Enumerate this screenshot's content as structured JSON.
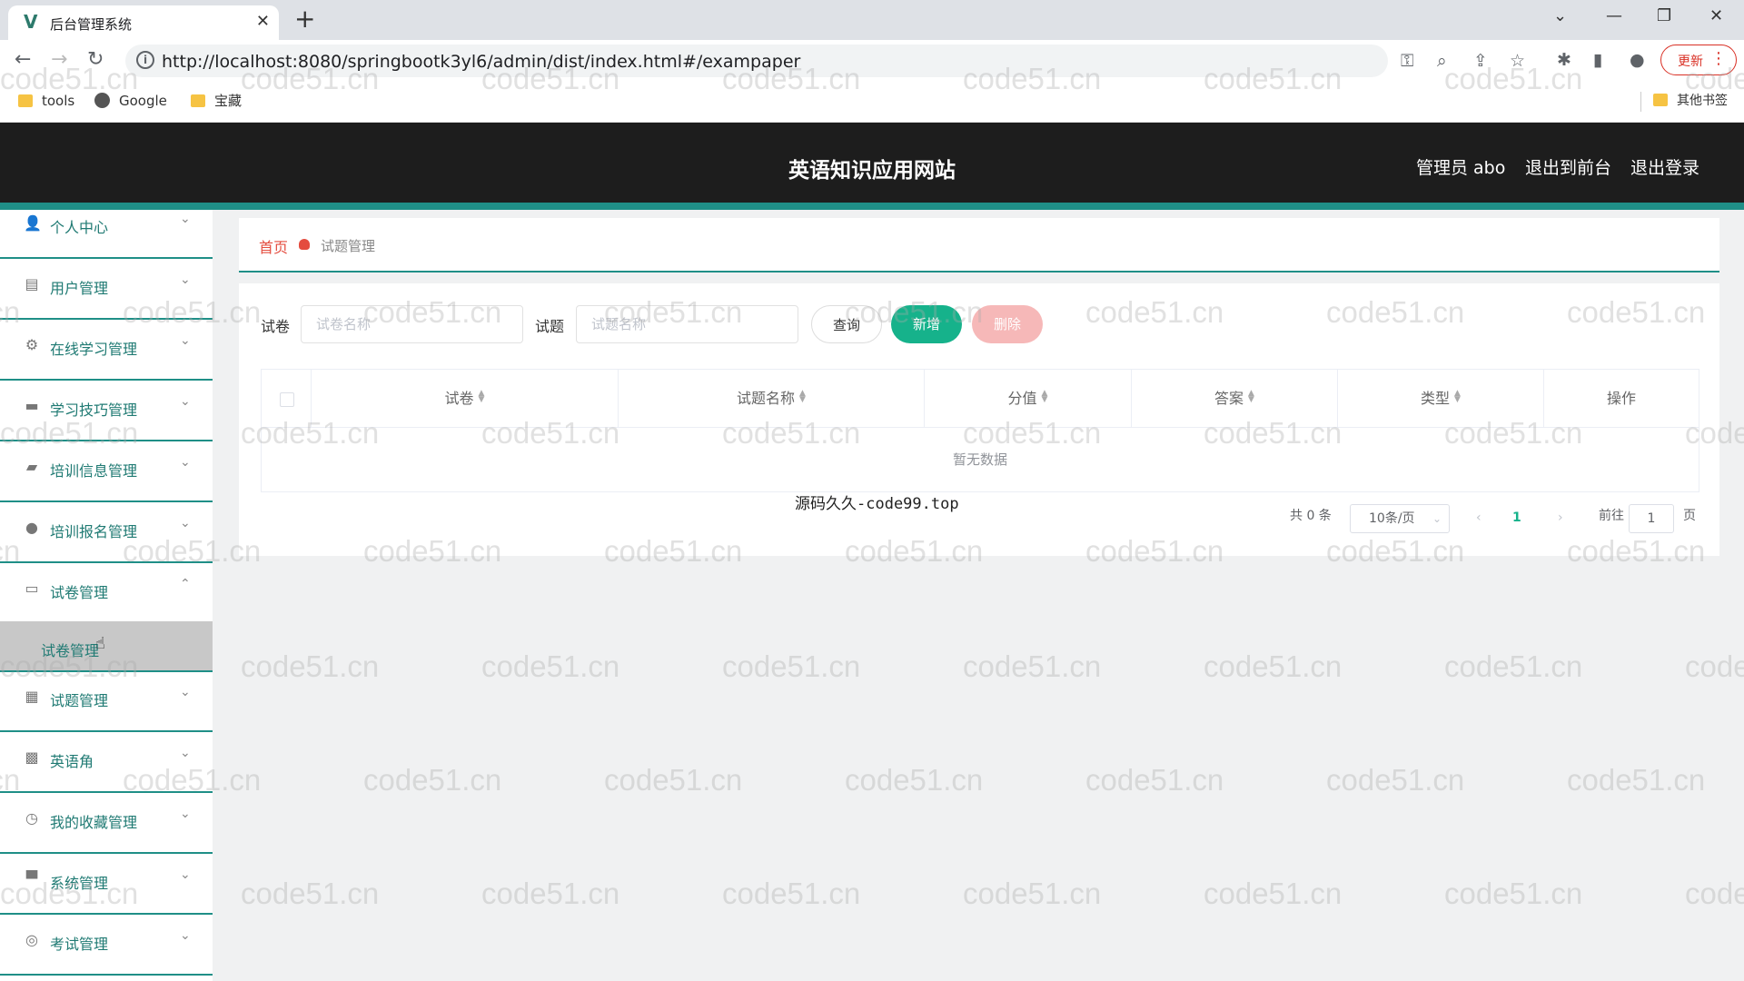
{
  "browser": {
    "tab_title": "后台管理系统",
    "tab_close": "✕",
    "new_tab": "+",
    "url": "http://localhost:8080/springbootk3yl6/admin/dist/index.html#/exampaper",
    "update_label": "更新",
    "bookmarks": [
      {
        "label": "tools",
        "icon": "folder-icon"
      },
      {
        "label": "Google",
        "icon": "globe-icon"
      },
      {
        "label": "宝藏",
        "icon": "folder-icon"
      }
    ],
    "other_bookmarks": "其他书签"
  },
  "header": {
    "title": "英语知识应用网站",
    "links": [
      "管理员 abo",
      "退出到前台",
      "退出登录"
    ],
    "accent": "#1f8f87",
    "background": "#1d1d1d"
  },
  "sidebar": {
    "items": [
      {
        "label": "个人中心",
        "icon": "user-icon",
        "arrow": "⌄"
      },
      {
        "label": "用户管理",
        "icon": "id-card-icon",
        "arrow": "⌄"
      },
      {
        "label": "在线学习管理",
        "icon": "settings-icon",
        "arrow": "⌄"
      },
      {
        "label": "学习技巧管理",
        "icon": "chat-icon",
        "arrow": "⌄"
      },
      {
        "label": "培训信息管理",
        "icon": "briefcase-icon",
        "arrow": "⌄"
      },
      {
        "label": "培训报名管理",
        "icon": "location-icon",
        "arrow": "⌄"
      },
      {
        "label": "试卷管理",
        "icon": "message-icon",
        "arrow": "⌃"
      },
      {
        "label": "试题管理",
        "icon": "monitor-icon",
        "arrow": "⌄"
      },
      {
        "label": "英语角",
        "icon": "chart-icon",
        "arrow": "⌄"
      },
      {
        "label": "我的收藏管理",
        "icon": "clock-icon",
        "arrow": "⌄"
      },
      {
        "label": "系统管理",
        "icon": "monitor-icon",
        "arrow": "⌄"
      },
      {
        "label": "考试管理",
        "icon": "compass-icon",
        "arrow": "⌄"
      }
    ],
    "submenu_active": "试卷管理"
  },
  "breadcrumb": {
    "home": "首页",
    "current": "试题管理"
  },
  "search": {
    "paper_label": "试卷",
    "paper_placeholder": "试卷名称",
    "question_label": "试题",
    "question_placeholder": "试题名称",
    "query_button": "查询",
    "add_button": "新增",
    "delete_button": "删除"
  },
  "table": {
    "columns": [
      "试卷",
      "试题名称",
      "分值",
      "答案",
      "类型",
      "操作"
    ],
    "empty_text": "暂无数据"
  },
  "pagination": {
    "total": "共 0 条",
    "page_size": "10条/页",
    "current_page": "1",
    "goto_label": "前往",
    "goto_value": "1",
    "page_suffix": "页"
  },
  "source_note": "源码久久-code99.top",
  "watermark": "code51.cn"
}
